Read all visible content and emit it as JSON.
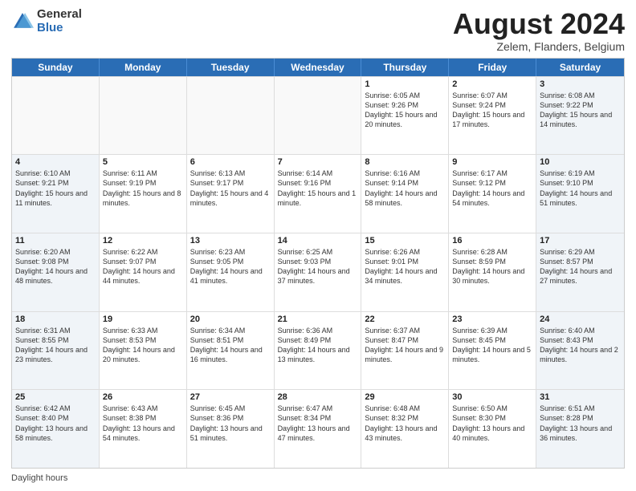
{
  "logo": {
    "general": "General",
    "blue": "Blue"
  },
  "title": "August 2024",
  "location": "Zelem, Flanders, Belgium",
  "days": [
    "Sunday",
    "Monday",
    "Tuesday",
    "Wednesday",
    "Thursday",
    "Friday",
    "Saturday"
  ],
  "footer": "Daylight hours",
  "weeks": [
    [
      {
        "day": "",
        "info": ""
      },
      {
        "day": "",
        "info": ""
      },
      {
        "day": "",
        "info": ""
      },
      {
        "day": "",
        "info": ""
      },
      {
        "day": "1",
        "info": "Sunrise: 6:05 AM\nSunset: 9:26 PM\nDaylight: 15 hours and 20 minutes."
      },
      {
        "day": "2",
        "info": "Sunrise: 6:07 AM\nSunset: 9:24 PM\nDaylight: 15 hours and 17 minutes."
      },
      {
        "day": "3",
        "info": "Sunrise: 6:08 AM\nSunset: 9:22 PM\nDaylight: 15 hours and 14 minutes."
      }
    ],
    [
      {
        "day": "4",
        "info": "Sunrise: 6:10 AM\nSunset: 9:21 PM\nDaylight: 15 hours and 11 minutes."
      },
      {
        "day": "5",
        "info": "Sunrise: 6:11 AM\nSunset: 9:19 PM\nDaylight: 15 hours and 8 minutes."
      },
      {
        "day": "6",
        "info": "Sunrise: 6:13 AM\nSunset: 9:17 PM\nDaylight: 15 hours and 4 minutes."
      },
      {
        "day": "7",
        "info": "Sunrise: 6:14 AM\nSunset: 9:16 PM\nDaylight: 15 hours and 1 minute."
      },
      {
        "day": "8",
        "info": "Sunrise: 6:16 AM\nSunset: 9:14 PM\nDaylight: 14 hours and 58 minutes."
      },
      {
        "day": "9",
        "info": "Sunrise: 6:17 AM\nSunset: 9:12 PM\nDaylight: 14 hours and 54 minutes."
      },
      {
        "day": "10",
        "info": "Sunrise: 6:19 AM\nSunset: 9:10 PM\nDaylight: 14 hours and 51 minutes."
      }
    ],
    [
      {
        "day": "11",
        "info": "Sunrise: 6:20 AM\nSunset: 9:08 PM\nDaylight: 14 hours and 48 minutes."
      },
      {
        "day": "12",
        "info": "Sunrise: 6:22 AM\nSunset: 9:07 PM\nDaylight: 14 hours and 44 minutes."
      },
      {
        "day": "13",
        "info": "Sunrise: 6:23 AM\nSunset: 9:05 PM\nDaylight: 14 hours and 41 minutes."
      },
      {
        "day": "14",
        "info": "Sunrise: 6:25 AM\nSunset: 9:03 PM\nDaylight: 14 hours and 37 minutes."
      },
      {
        "day": "15",
        "info": "Sunrise: 6:26 AM\nSunset: 9:01 PM\nDaylight: 14 hours and 34 minutes."
      },
      {
        "day": "16",
        "info": "Sunrise: 6:28 AM\nSunset: 8:59 PM\nDaylight: 14 hours and 30 minutes."
      },
      {
        "day": "17",
        "info": "Sunrise: 6:29 AM\nSunset: 8:57 PM\nDaylight: 14 hours and 27 minutes."
      }
    ],
    [
      {
        "day": "18",
        "info": "Sunrise: 6:31 AM\nSunset: 8:55 PM\nDaylight: 14 hours and 23 minutes."
      },
      {
        "day": "19",
        "info": "Sunrise: 6:33 AM\nSunset: 8:53 PM\nDaylight: 14 hours and 20 minutes."
      },
      {
        "day": "20",
        "info": "Sunrise: 6:34 AM\nSunset: 8:51 PM\nDaylight: 14 hours and 16 minutes."
      },
      {
        "day": "21",
        "info": "Sunrise: 6:36 AM\nSunset: 8:49 PM\nDaylight: 14 hours and 13 minutes."
      },
      {
        "day": "22",
        "info": "Sunrise: 6:37 AM\nSunset: 8:47 PM\nDaylight: 14 hours and 9 minutes."
      },
      {
        "day": "23",
        "info": "Sunrise: 6:39 AM\nSunset: 8:45 PM\nDaylight: 14 hours and 5 minutes."
      },
      {
        "day": "24",
        "info": "Sunrise: 6:40 AM\nSunset: 8:43 PM\nDaylight: 14 hours and 2 minutes."
      }
    ],
    [
      {
        "day": "25",
        "info": "Sunrise: 6:42 AM\nSunset: 8:40 PM\nDaylight: 13 hours and 58 minutes."
      },
      {
        "day": "26",
        "info": "Sunrise: 6:43 AM\nSunset: 8:38 PM\nDaylight: 13 hours and 54 minutes."
      },
      {
        "day": "27",
        "info": "Sunrise: 6:45 AM\nSunset: 8:36 PM\nDaylight: 13 hours and 51 minutes."
      },
      {
        "day": "28",
        "info": "Sunrise: 6:47 AM\nSunset: 8:34 PM\nDaylight: 13 hours and 47 minutes."
      },
      {
        "day": "29",
        "info": "Sunrise: 6:48 AM\nSunset: 8:32 PM\nDaylight: 13 hours and 43 minutes."
      },
      {
        "day": "30",
        "info": "Sunrise: 6:50 AM\nSunset: 8:30 PM\nDaylight: 13 hours and 40 minutes."
      },
      {
        "day": "31",
        "info": "Sunrise: 6:51 AM\nSunset: 8:28 PM\nDaylight: 13 hours and 36 minutes."
      }
    ]
  ]
}
